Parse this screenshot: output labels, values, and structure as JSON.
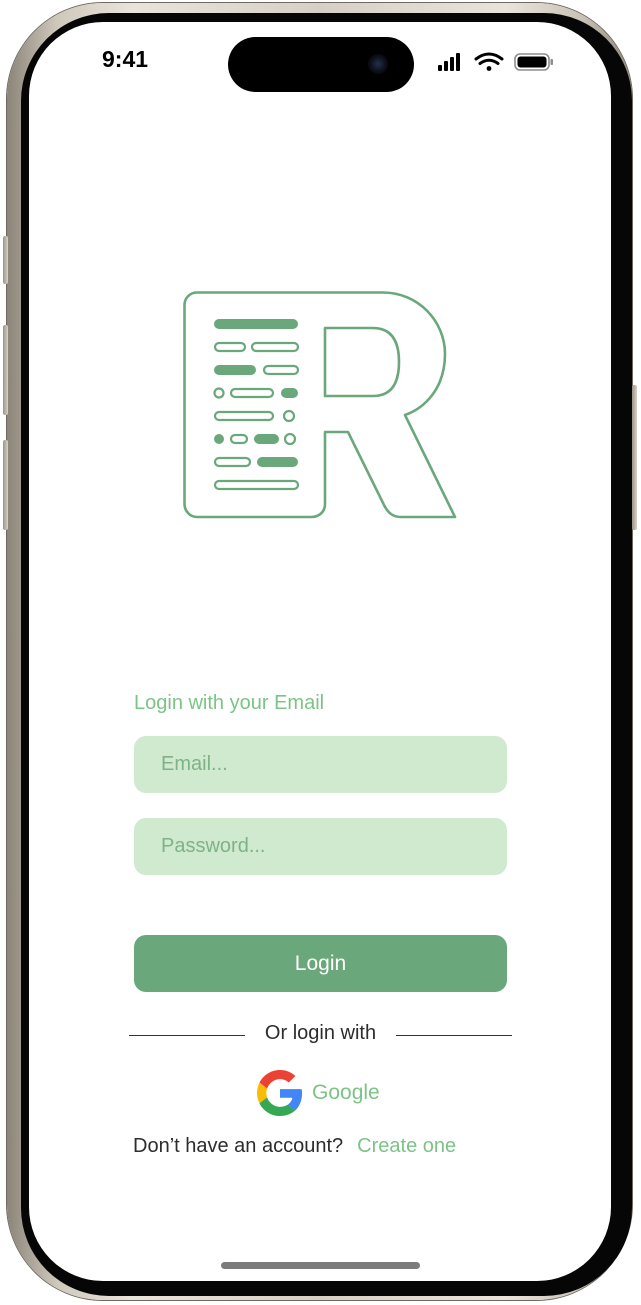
{
  "status_bar": {
    "time": "9:41",
    "icons": [
      "cellular-signal-icon",
      "wifi-icon",
      "battery-icon"
    ]
  },
  "logo": {
    "letter": "R",
    "color": "#6aa87b"
  },
  "login": {
    "heading": "Login with your Email",
    "email_placeholder": "Email...",
    "email_value": "",
    "password_placeholder": "Password...",
    "password_value": "",
    "button_label": "Login"
  },
  "alt_login": {
    "divider_text": "Or login with",
    "google_label": "Google"
  },
  "signup": {
    "prompt": "Don’t have an account?",
    "link_label": "Create one"
  },
  "colors": {
    "accent": "#6aa87b",
    "accent_light_text": "#7cc486",
    "field_background": "#d0ead0"
  }
}
